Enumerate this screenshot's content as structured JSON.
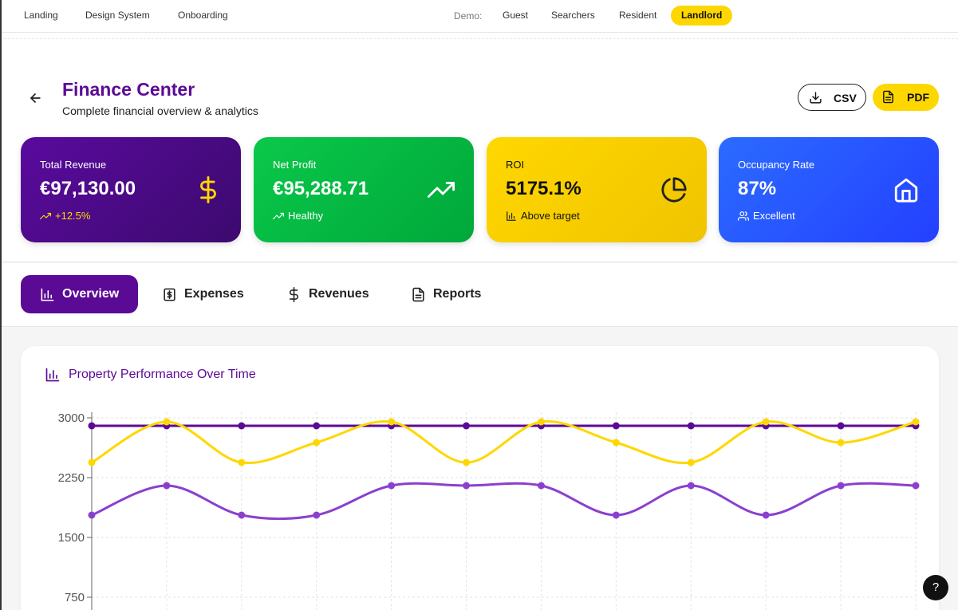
{
  "topnav": {
    "links": [
      "Landing",
      "Design System",
      "Onboarding"
    ],
    "demo_label": "Demo:",
    "demo_options": [
      "Guest",
      "Searchers",
      "Resident",
      "Landlord"
    ],
    "demo_selected": "Landlord"
  },
  "header": {
    "title": "Finance Center",
    "subtitle": "Complete financial overview & analytics",
    "csv_label": "CSV",
    "pdf_label": "PDF"
  },
  "cards": [
    {
      "label": "Total Revenue",
      "value": "€97,130.00",
      "sub": "+12.5%",
      "icon": "dollar-icon",
      "color": "#5a0a9e"
    },
    {
      "label": "Net Profit",
      "value": "€95,288.71",
      "sub": "Healthy",
      "icon": "trending-up-icon",
      "color": "#0ac84a"
    },
    {
      "label": "ROI",
      "value": "5175.1%",
      "sub": "Above target",
      "icon": "pie-chart-icon",
      "color": "#ffd700"
    },
    {
      "label": "Occupancy Rate",
      "value": "87%",
      "sub": "Excellent",
      "icon": "home-icon",
      "color": "#2b6bff"
    }
  ],
  "tabs": [
    {
      "label": "Overview",
      "icon": "bar-chart-icon",
      "active": true
    },
    {
      "label": "Expenses",
      "icon": "receipt-icon",
      "active": false
    },
    {
      "label": "Revenues",
      "icon": "dollar-icon",
      "active": false
    },
    {
      "label": "Reports",
      "icon": "file-icon",
      "active": false
    }
  ],
  "panel": {
    "title": "Property Performance Over Time"
  },
  "help_label": "?",
  "chart_data": {
    "type": "line",
    "title": "Property Performance Over Time",
    "x_count": 12,
    "y_ticks": [
      3000,
      2250,
      1500,
      750
    ],
    "ylim": [
      0,
      3000
    ],
    "grid": true,
    "series": [
      {
        "color": "#5b0a96",
        "values": [
          2900,
          2900,
          2900,
          2900,
          2900,
          2900,
          2900,
          2900,
          2900,
          2900,
          2900,
          2900
        ]
      },
      {
        "color": "#ffd700",
        "values": [
          2440,
          2950,
          2440,
          2690,
          2950,
          2440,
          2950,
          2690,
          2440,
          2950,
          2690,
          2950
        ]
      },
      {
        "color": "#8b3fcf",
        "values": [
          1780,
          2150,
          1780,
          1780,
          2150,
          2150,
          2150,
          1780,
          2150,
          1780,
          2150,
          2150
        ]
      }
    ]
  }
}
